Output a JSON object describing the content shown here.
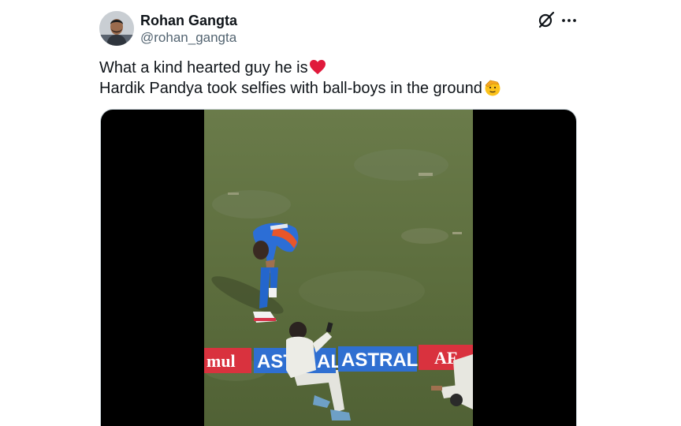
{
  "author": {
    "display_name": "Rohan Gangta",
    "handle": "@rohan_gangta",
    "avatar_icon": "avatar-photo"
  },
  "header_actions": {
    "grok_icon": "grok-icon",
    "more_icon": "more-icon"
  },
  "tweet": {
    "line1": "What a kind hearted guy he is",
    "line1_emoji": "red-heart",
    "line2": "Hardik Pandya took selfies with ball-boys in the ground",
    "line2_emoji": "saluting-face"
  },
  "media": {
    "type": "video",
    "boards": {
      "left": "mul",
      "center_a": "AST",
      "center_b": "AL",
      "center_c": "ASTRAL",
      "right": "AF"
    }
  },
  "colors": {
    "text": "#0f1419",
    "secondary_text": "#536471",
    "heart": "#e0193b",
    "astral_blue": "#2f6fd1",
    "board_red": "#d9323e",
    "pitch_green": "#5d6e3e"
  }
}
